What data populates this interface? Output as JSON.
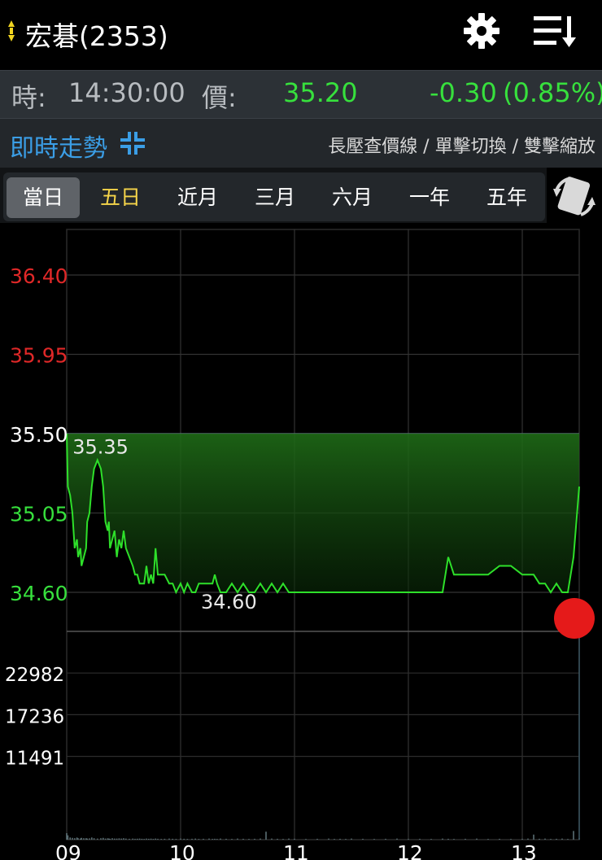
{
  "header": {
    "title": "宏碁(2353)",
    "icons": [
      "gear-icon",
      "sort-list-icon"
    ]
  },
  "quote": {
    "time_label": "時:",
    "time": "14:30:00",
    "price_label": "價:",
    "price": "35.20",
    "change": "-0.30",
    "change_pct": "(0.85%)",
    "color": "#37e03d"
  },
  "mode": {
    "title": "即時走勢",
    "hint": "長壓查價線 / 單擊切換 / 雙擊縮放"
  },
  "tabs": [
    "當日",
    "五日",
    "近月",
    "三月",
    "六月",
    "一年",
    "五年"
  ],
  "colors": {
    "line": "#2ee02a",
    "up": "#e02828",
    "down": "#37e03d",
    "marker": "#e51a1a"
  },
  "chart_data": {
    "type": "area",
    "price_axis": {
      "ticks": [
        "36.40",
        "35.95",
        "35.50",
        "35.05",
        "34.60"
      ],
      "ylim": [
        34.6,
        36.4
      ],
      "reference": 35.5
    },
    "volume_axis": {
      "ticks": [
        "22982",
        "17236",
        "11491"
      ],
      "ylim": [
        0,
        28728
      ]
    },
    "x_ticks": [
      "09",
      "10",
      "11",
      "12",
      "13"
    ],
    "annotations": {
      "high": "35.35",
      "low": "34.60"
    },
    "x_hours": [
      9,
      9.01,
      9.03,
      9.05,
      9.07,
      9.09,
      9.1,
      9.12,
      9.13,
      9.15,
      9.17,
      9.18,
      9.2,
      9.22,
      9.24,
      9.27,
      9.3,
      9.32,
      9.34,
      9.36,
      9.37,
      9.38,
      9.4,
      9.42,
      9.44,
      9.46,
      9.48,
      9.5,
      9.52,
      9.55,
      9.58,
      9.6,
      9.62,
      9.64,
      9.66,
      9.68,
      9.7,
      9.72,
      9.74,
      9.76,
      9.78,
      9.8,
      9.83,
      9.86,
      9.9,
      9.93,
      9.96,
      10,
      10.03,
      10.06,
      10.1,
      10.13,
      10.16,
      10.2,
      10.25,
      10.28,
      10.3,
      10.32,
      10.35,
      10.4,
      10.45,
      10.5,
      10.55,
      10.6,
      10.65,
      10.7,
      10.75,
      10.8,
      10.85,
      10.9,
      10.95,
      11,
      11.1,
      11.2,
      11.3,
      11.35,
      11.4,
      11.45,
      11.5,
      11.6,
      11.7,
      11.8,
      11.9,
      12,
      12.1,
      12.2,
      12.3,
      12.35,
      12.4,
      12.5,
      12.6,
      12.7,
      12.8,
      12.9,
      13,
      13.05,
      13.1,
      13.15,
      13.2,
      13.25,
      13.3,
      13.35,
      13.4,
      13.45,
      13.5
    ],
    "prices": [
      35.5,
      35.2,
      35.15,
      35.05,
      34.85,
      34.9,
      34.8,
      34.85,
      34.75,
      34.8,
      34.85,
      35.0,
      35.05,
      35.2,
      35.3,
      35.35,
      35.3,
      35.2,
      35.0,
      34.95,
      35.0,
      34.85,
      34.9,
      34.95,
      34.8,
      34.9,
      34.85,
      34.95,
      34.85,
      34.8,
      34.75,
      34.7,
      34.7,
      34.65,
      34.65,
      34.65,
      34.75,
      34.65,
      34.7,
      34.65,
      34.85,
      34.7,
      34.7,
      34.7,
      34.65,
      34.65,
      34.6,
      34.65,
      34.6,
      34.65,
      34.6,
      34.6,
      34.65,
      34.65,
      34.65,
      34.65,
      34.7,
      34.65,
      34.6,
      34.6,
      34.65,
      34.6,
      34.65,
      34.6,
      34.6,
      34.65,
      34.6,
      34.65,
      34.6,
      34.65,
      34.6,
      34.6,
      34.6,
      34.6,
      34.6,
      34.6,
      34.6,
      34.6,
      34.6,
      34.6,
      34.6,
      34.6,
      34.6,
      34.6,
      34.6,
      34.6,
      34.6,
      34.8,
      34.7,
      34.7,
      34.7,
      34.7,
      34.75,
      34.75,
      34.7,
      34.7,
      34.7,
      34.65,
      34.65,
      34.6,
      34.65,
      34.6,
      34.6,
      34.8,
      35.2
    ],
    "volumes": [
      900,
      600,
      300,
      250,
      200,
      300,
      200,
      150,
      250,
      200,
      200,
      150,
      180,
      300,
      200,
      150,
      200,
      250,
      150,
      180,
      150,
      120,
      200,
      150,
      150,
      180,
      150,
      200,
      150,
      120,
      150,
      120,
      130,
      150,
      120,
      100,
      150,
      120,
      140,
      100,
      150,
      120,
      100,
      120,
      150,
      120,
      100,
      150,
      120,
      100,
      120,
      150,
      100,
      120,
      150,
      100,
      120,
      100,
      150,
      120,
      100,
      150,
      120,
      100,
      120,
      150,
      1100,
      150,
      120,
      100,
      150,
      120,
      100,
      120,
      150,
      100,
      120,
      100,
      150,
      120,
      100,
      120,
      150,
      100,
      120,
      100,
      150,
      120,
      100,
      120,
      150,
      100,
      120,
      100,
      120,
      150,
      700,
      120,
      150,
      100,
      120,
      150,
      100,
      1200,
      200
    ],
    "last_price": "35.20"
  }
}
